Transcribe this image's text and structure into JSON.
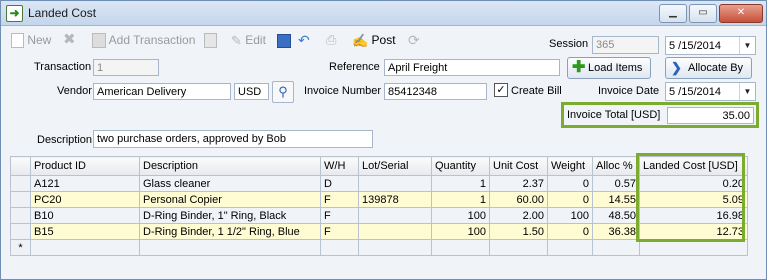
{
  "window": {
    "title": "Landed Cost"
  },
  "toolbar": {
    "new": "New",
    "add_transaction": "Add Transaction",
    "edit": "Edit",
    "post": "Post",
    "session_label": "Session",
    "session_value": "365",
    "date_value": "5 /15/2014"
  },
  "form": {
    "transaction_label": "Transaction",
    "transaction_value": "1",
    "reference_label": "Reference",
    "reference_value": "April Freight",
    "load_items": "Load Items",
    "allocate_by": "Allocate By",
    "vendor_label": "Vendor",
    "vendor_value": "American Delivery",
    "currency": "USD",
    "invoice_number_label": "Invoice Number",
    "invoice_number_value": "85412348",
    "create_bill_label": "Create Bill",
    "invoice_date_label": "Invoice Date",
    "invoice_date_value": "5 /15/2014",
    "invoice_total_label": "Invoice Total [USD]",
    "invoice_total_value": "35.00",
    "description_label": "Description",
    "description_value": "two purchase orders, approved by Bob"
  },
  "grid": {
    "columns": [
      "Product ID",
      "Description",
      "W/H",
      "Lot/Serial",
      "Quantity",
      "Unit Cost",
      "Weight",
      "Alloc %",
      "Landed Cost [USD]"
    ],
    "rows": [
      [
        "A121",
        "Glass cleaner",
        "D",
        "",
        "1",
        "2.37",
        "0",
        "0.57",
        "0.20"
      ],
      [
        "PC20",
        "Personal Copier",
        "F",
        "139878",
        "1",
        "60.00",
        "0",
        "14.55",
        "5.09"
      ],
      [
        "B10",
        "D-Ring Binder, 1\" Ring, Black",
        "F",
        "",
        "100",
        "2.00",
        "100",
        "48.50",
        "16.98"
      ],
      [
        "B15",
        "D-Ring Binder, 1 1/2\" Ring, Blue",
        "F",
        "",
        "100",
        "1.50",
        "0",
        "36.38",
        "12.73"
      ]
    ],
    "new_row_marker": "*"
  },
  "colors": {
    "highlight": "#7bac2f",
    "alt_row": "#fffbd2"
  }
}
